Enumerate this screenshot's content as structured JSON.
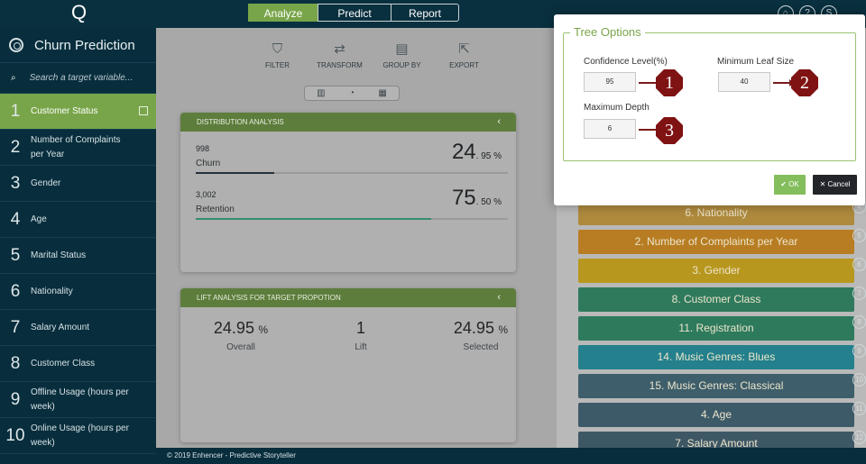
{
  "topbar": {
    "logo": "Q",
    "steps": [
      "Analyze",
      "Predict",
      "Report"
    ],
    "icons": [
      "home-icon",
      "help-icon",
      "user-icon"
    ]
  },
  "sidebar": {
    "title": "Churn Prediction",
    "search_placeholder": "Search a target variable...",
    "items": [
      {
        "num": "1",
        "label": "Customer Status"
      },
      {
        "num": "2",
        "label": "Number of Complaints per Year"
      },
      {
        "num": "3",
        "label": "Gender"
      },
      {
        "num": "4",
        "label": "Age"
      },
      {
        "num": "5",
        "label": "Marital Status"
      },
      {
        "num": "6",
        "label": "Nationality"
      },
      {
        "num": "7",
        "label": "Salary Amount"
      },
      {
        "num": "8",
        "label": "Customer Class"
      },
      {
        "num": "9",
        "label": "Offline Usage (hours per week)"
      },
      {
        "num": "10",
        "label": "Online Usage (hours per week)"
      }
    ]
  },
  "toolbar": {
    "filter": "FILTER",
    "transform": "TRANSFORM",
    "groupby": "GROUP BY",
    "export": "EXPORT"
  },
  "distribution": {
    "title": "DISTRIBUTION ANALYSIS",
    "rows": [
      {
        "count": "998",
        "label": "Churn",
        "pct_main": "24",
        "pct_dec": ". 95 %",
        "fill": 0.25,
        "color": "#24303a"
      },
      {
        "count": "3,002",
        "label": "Retention",
        "pct_main": "75",
        "pct_dec": ". 50 %",
        "fill": 0.755,
        "color": "#358c6a"
      }
    ]
  },
  "lift": {
    "title": "LIFT ANALYSIS FOR TARGET PROPOTION",
    "overall_value": "24.95",
    "overall_unit": "%",
    "overall_label": "Overall",
    "lift_value": "1",
    "lift_label": "Lift",
    "selected_value": "24.95",
    "selected_unit": "%",
    "selected_label": "Selected"
  },
  "footer": "© 2019 Enhencer -   Predictive Storyteller",
  "variables": [
    {
      "label": "6. Nationality",
      "rank": "4",
      "color": "#af8a3d"
    },
    {
      "label": "2. Number of Complaints per Year",
      "rank": "5",
      "color": "#b87d22"
    },
    {
      "label": "3. Gender",
      "rank": "6",
      "color": "#b8971e"
    },
    {
      "label": "8. Customer Class",
      "rank": "7",
      "color": "#2f7a5d"
    },
    {
      "label": "11. Registration",
      "rank": "8",
      "color": "#2e7a5d"
    },
    {
      "label": "14. Music Genres: Blues",
      "rank": "9",
      "color": "#23808c"
    },
    {
      "label": "15. Music Genres: Classical",
      "rank": "10",
      "color": "#3e5e6b"
    },
    {
      "label": "4. Age",
      "rank": "11",
      "color": "#3d5a68"
    },
    {
      "label": "7. Salary Amount",
      "rank": "12",
      "color": "#3e5765"
    }
  ],
  "modal": {
    "legend": "Tree Options",
    "confidence_label": "Confidence Level(%)",
    "confidence_value": "95",
    "leaf_label": "Minimum Leaf Size",
    "leaf_value": "40",
    "depth_label": "Maximum Depth",
    "depth_value": "6",
    "marker1": "1",
    "marker2": "2",
    "marker3": "3",
    "ok": "OK",
    "cancel": "Cancel"
  }
}
